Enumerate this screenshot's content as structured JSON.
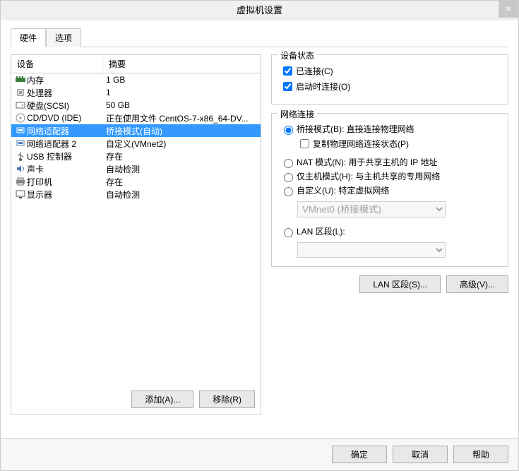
{
  "title": "虚拟机设置",
  "tabs": {
    "hardware": "硬件",
    "options": "选项"
  },
  "list": {
    "h_device": "设备",
    "h_summary": "摘要",
    "rows": [
      {
        "name": "内存",
        "summary": "1 GB",
        "icon": "memory"
      },
      {
        "name": "处理器",
        "summary": "1",
        "icon": "cpu"
      },
      {
        "name": "硬盘(SCSI)",
        "summary": "50 GB",
        "icon": "disk"
      },
      {
        "name": "CD/DVD (IDE)",
        "summary": "正在使用文件 CentOS-7-x86_64-DV...",
        "icon": "cd"
      },
      {
        "name": "网络适配器",
        "summary": "桥接模式(自动)",
        "icon": "net"
      },
      {
        "name": "网络适配器 2",
        "summary": "自定义(VMnet2)",
        "icon": "net"
      },
      {
        "name": "USB 控制器",
        "summary": "存在",
        "icon": "usb"
      },
      {
        "name": "声卡",
        "summary": "自动检测",
        "icon": "sound"
      },
      {
        "name": "打印机",
        "summary": "存在",
        "icon": "printer"
      },
      {
        "name": "显示器",
        "summary": "自动检测",
        "icon": "display"
      }
    ],
    "add": "添加(A)...",
    "remove": "移除(R)"
  },
  "status": {
    "title": "设备状态",
    "connected": "已连接(C)",
    "connect_on_start": "启动时连接(O)"
  },
  "net": {
    "title": "网络连接",
    "bridged": "桥接模式(B): 直接连接物理网络",
    "replicate": "复制物理网络连接状态(P)",
    "nat": "NAT 模式(N): 用于共享主机的 IP 地址",
    "hostonly": "仅主机模式(H): 与主机共享的专用网络",
    "custom": "自定义(U): 特定虚拟网络",
    "custom_value": "VMnet0 (桥接模式)",
    "lanseg": "LAN 区段(L):",
    "btn_lanseg": "LAN 区段(S)...",
    "btn_adv": "高级(V)..."
  },
  "footer": {
    "ok": "确定",
    "cancel": "取消",
    "help": "帮助"
  }
}
